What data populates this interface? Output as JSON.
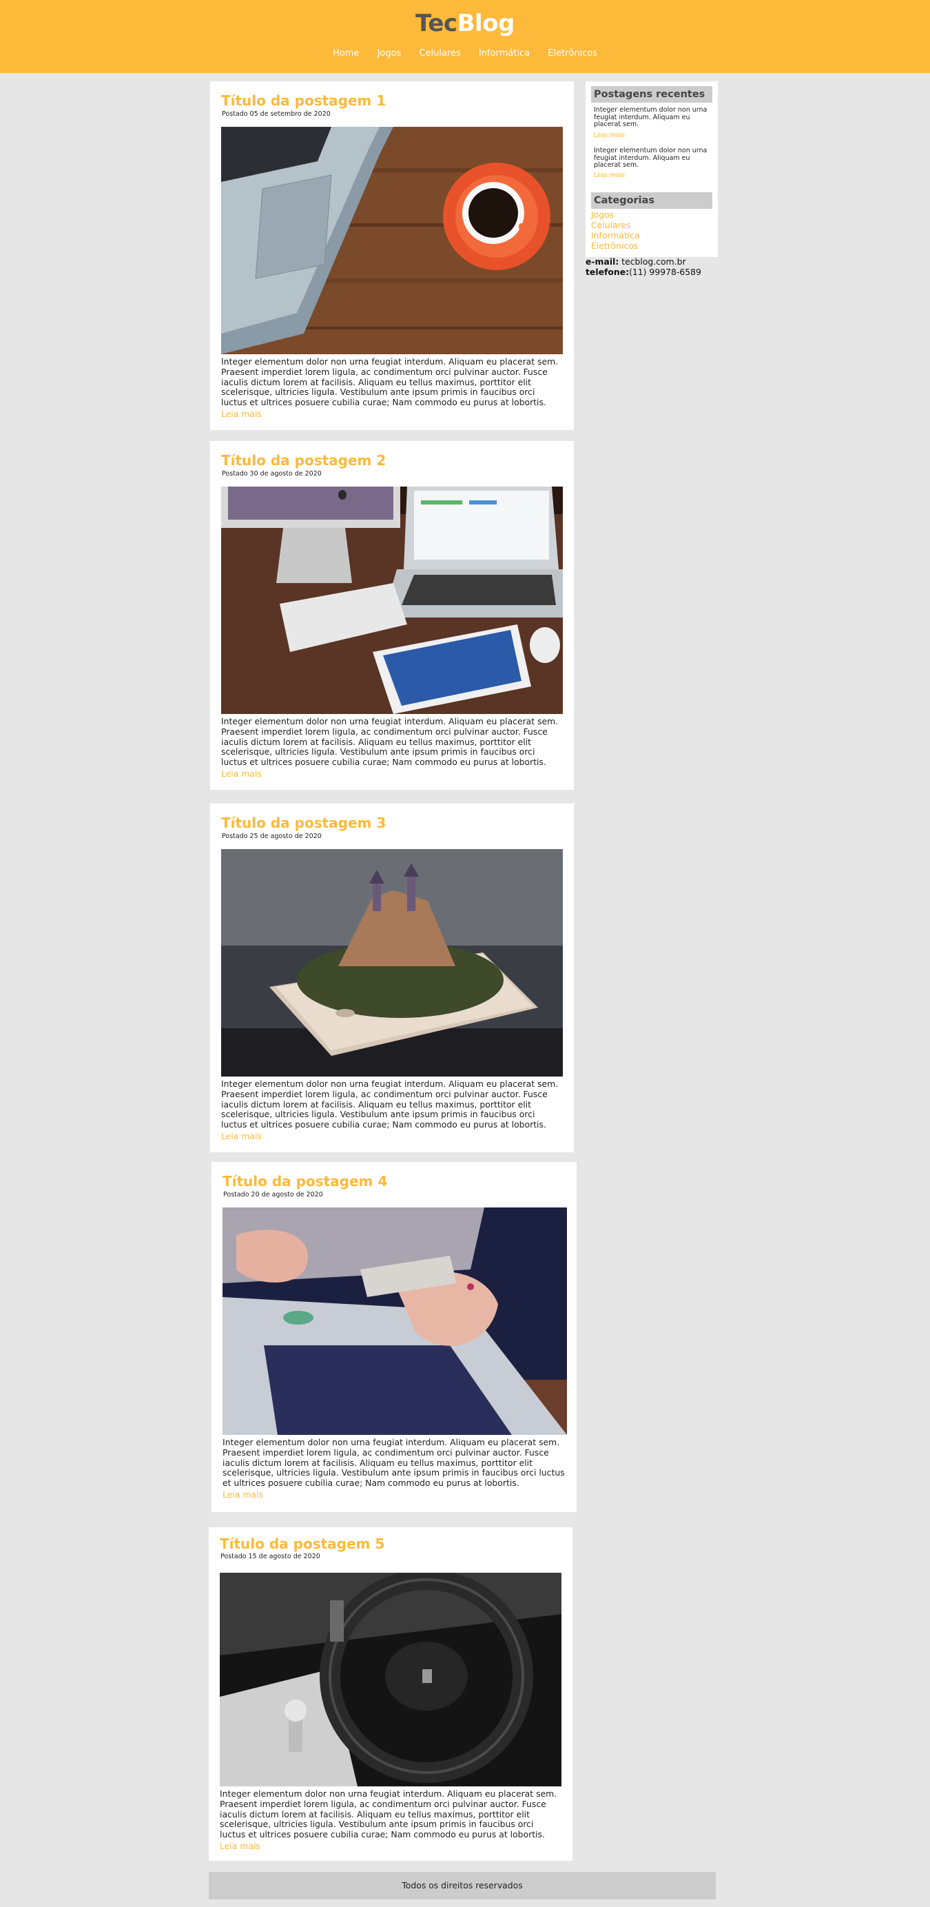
{
  "header": {
    "logo_part1": "Tec",
    "logo_part2": "Blog",
    "nav": [
      "Home",
      "Jogos",
      "Celulares",
      "Informática",
      "Eletrônicos"
    ]
  },
  "posts": [
    {
      "title": "Título da postagem 1",
      "date": "Postado 05 de setembro de 2020",
      "image": "laptop-and-coffee-photo",
      "text": "Integer elementum dolor non urna feugiat interdum. Aliquam eu placerat sem. Praesent imperdiet lorem ligula, ac condimentum orci pulvinar auctor. Fusce iaculis dictum lorem at facilisis. Aliquam eu tellus maximus, porttitor elit scelerisque, ultricies ligula. Vestibulum ante ipsum primis in faucibus orci luctus et ultrices posuere cubilia curae; Nam commodo eu purus at lobortis.",
      "read_more": "Leia mais"
    },
    {
      "title": "Título da postagem 2",
      "date": "Postado 30 de agosto de 2020",
      "image": "imac-macbook-ipad-desk-photo",
      "text": "Integer elementum dolor non urna feugiat interdum. Aliquam eu placerat sem. Praesent imperdiet lorem ligula, ac condimentum orci pulvinar auctor. Fusce iaculis dictum lorem at facilisis. Aliquam eu tellus maximus, porttitor elit scelerisque, ultricies ligula. Vestibulum ante ipsum primis in faucibus orci luctus et ultrices posuere cubilia curae; Nam commodo eu purus at lobortis.",
      "read_more": "Leia mais"
    },
    {
      "title": "Título da postagem 3",
      "date": "Postado 25 de agosto de 2020",
      "image": "castle-on-smartphone-photo",
      "text": "Integer elementum dolor non urna feugiat interdum. Aliquam eu placerat sem. Praesent imperdiet lorem ligula, ac condimentum orci pulvinar auctor. Fusce iaculis dictum lorem at facilisis. Aliquam eu tellus maximus, porttitor elit scelerisque, ultricies ligula. Vestibulum ante ipsum primis in faucibus orci luctus et ultrices posuere cubilia curae; Nam commodo eu purus at lobortis.",
      "read_more": "Leia mais"
    },
    {
      "title": "Título da postagem 4",
      "date": "Postado 20 de agosto de 2020",
      "image": "hands-phone-laptop-photo",
      "text": "Integer elementum dolor non urna feugiat interdum. Aliquam eu placerat sem. Praesent imperdiet lorem ligula, ac condimentum orci pulvinar auctor. Fusce iaculis dictum lorem at facilisis. Aliquam eu tellus maximus, porttitor elit scelerisque, ultricies ligula. Vestibulum ante ipsum primis in faucibus orci luctus et ultrices posuere cubilia curae; Nam commodo eu purus at lobortis.",
      "read_more": "Leia mais"
    },
    {
      "title": "Título da postagem 5",
      "date": "Postado 15 de agosto de 2020",
      "image": "ferrari-steering-wheel-photo",
      "text": "Integer elementum dolor non urna feugiat interdum. Aliquam eu placerat sem. Praesent imperdiet lorem ligula, ac condimentum orci pulvinar auctor. Fusce iaculis dictum lorem at facilisis. Aliquam eu tellus maximus, porttitor elit scelerisque, ultricies ligula. Vestibulum ante ipsum primis in faucibus orci luctus et ultrices posuere cubilia curae; Nam commodo eu purus at lobortis.",
      "read_more": "Leia mais"
    }
  ],
  "sidebar": {
    "recent_title": "Postagens recentes",
    "recent": [
      {
        "text": "Integer elementum dolor non urna feugiat interdum. Aliquam eu placerat sem.",
        "link": "Leia mais"
      },
      {
        "text": "Integer elementum dolor non urna feugiat interdum. Aliquam eu placerat sem.",
        "link": "Leia mais"
      }
    ],
    "categories_title": "Categorias",
    "categories": [
      "Jogos",
      "Celulares",
      "Informática",
      "Eletrônicos"
    ],
    "email_label": "e-mail:",
    "email_value": "tecblog.com.br",
    "phone_label": "telefone:",
    "phone_value": "(11) 99978-6589"
  },
  "footer": {
    "text": "Todos os direitos reservados"
  },
  "colors": {
    "accent": "#fdb93a",
    "page_bg": "#e6e6e6",
    "box_bg": "#ffffff",
    "footer_bg": "#cccccc"
  }
}
